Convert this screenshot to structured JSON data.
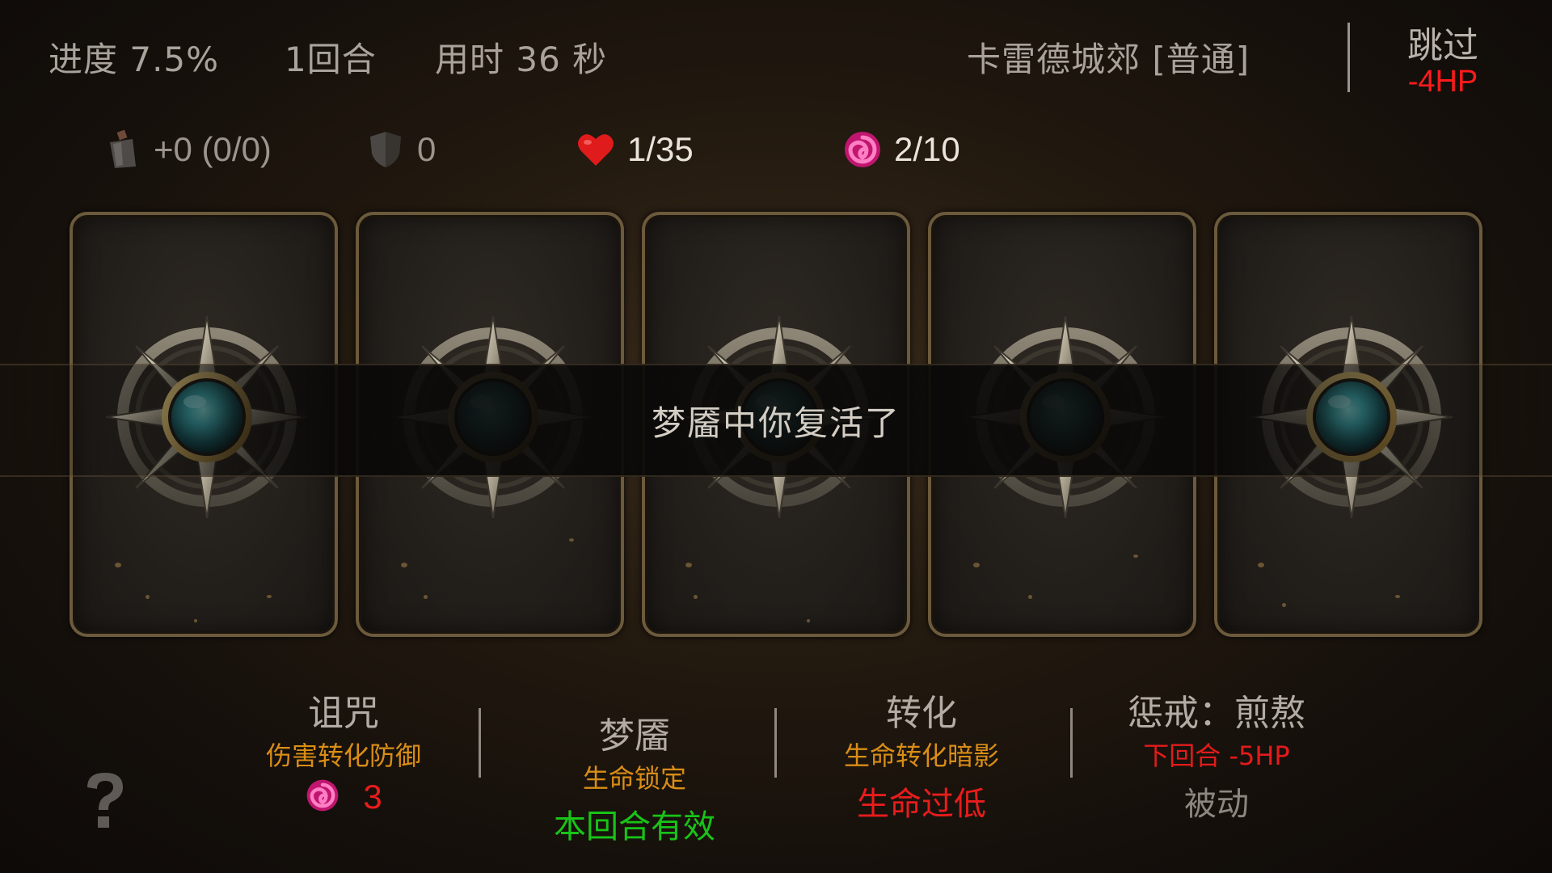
{
  "header": {
    "progress": "进度 7.5%",
    "round": "1回合",
    "time": "用时 36 秒",
    "location": "卡雷德城郊 [普通]",
    "skip_label": "跳过",
    "skip_cost": "-4HP"
  },
  "stats": {
    "attack": {
      "icon": "sword-icon",
      "value": "+0 (0/0)"
    },
    "armor": {
      "icon": "shield-icon",
      "value": "0"
    },
    "health": {
      "icon": "heart-icon",
      "value": "1/35",
      "color": "#e01b1b"
    },
    "shadow": {
      "icon": "swirl-icon",
      "value": "2/10",
      "color": "#e0208a"
    }
  },
  "cards": [
    {
      "emblem": "compass-orb-emblem"
    },
    {
      "emblem": "compass-orb-emblem"
    },
    {
      "emblem": "compass-orb-emblem"
    },
    {
      "emblem": "compass-orb-emblem"
    },
    {
      "emblem": "compass-orb-emblem"
    }
  ],
  "banner": {
    "message": "梦靥中你复活了"
  },
  "effects": [
    {
      "title": "诅咒",
      "subtitle": "伤害转化防御",
      "value": "3",
      "icon": "swirl-icon"
    },
    {
      "title": "梦靥",
      "subtitle": "生命锁定",
      "status": "本回合有效"
    },
    {
      "title": "转化",
      "subtitle": "生命转化暗影",
      "status": "生命过低"
    },
    {
      "title": "惩戒：煎熬",
      "subtitle": "下回合 -5HP",
      "status": "被动"
    }
  ],
  "colors": {
    "accent_red": "#ff1b1b",
    "accent_orange": "#d98d16",
    "accent_green": "#18c418",
    "card_border": "#6b5a3c"
  }
}
